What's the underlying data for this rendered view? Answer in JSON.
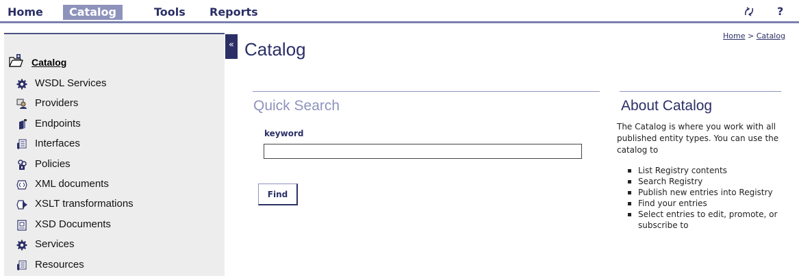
{
  "nav": {
    "items": [
      "Home",
      "Catalog",
      "Tools",
      "Reports"
    ],
    "help": "?"
  },
  "sidebar": {
    "collapse": "«",
    "title": "Catalog",
    "items": [
      {
        "label": "WSDL Services",
        "icon": "gear-icon"
      },
      {
        "label": "Providers",
        "icon": "provider-icon"
      },
      {
        "label": "Endpoints",
        "icon": "endpoint-icon"
      },
      {
        "label": "Interfaces",
        "icon": "interface-icon"
      },
      {
        "label": "Policies",
        "icon": "policy-icon"
      },
      {
        "label": "XML documents",
        "icon": "xml-document-icon"
      },
      {
        "label": "XSLT transformations",
        "icon": "xslt-icon"
      },
      {
        "label": "XSD Documents",
        "icon": "xsd-document-icon"
      },
      {
        "label": "Services",
        "icon": "gear-icon"
      },
      {
        "label": "Resources",
        "icon": "resource-icon"
      }
    ]
  },
  "main": {
    "title": "Catalog",
    "breadcrumb": [
      "Home",
      "Catalog"
    ],
    "breadcrumb_sep": " > ",
    "quick_search": {
      "title": "Quick Search",
      "keyword_label": "keyword",
      "keyword_value": "",
      "find_label": "Find"
    },
    "about": {
      "title": "About Catalog",
      "text": "The Catalog is where you work with all published entity types. You can use the catalog to",
      "items": [
        "List Registry contents",
        "Search Registry",
        "Publish new entries into Registry",
        "Find your entries",
        "Select entries to edit, promote, or subscribe to"
      ]
    }
  },
  "colors": {
    "navy": "#2b2f66",
    "lavender": "#8e93bc",
    "sidebar_bg": "#ededed"
  }
}
